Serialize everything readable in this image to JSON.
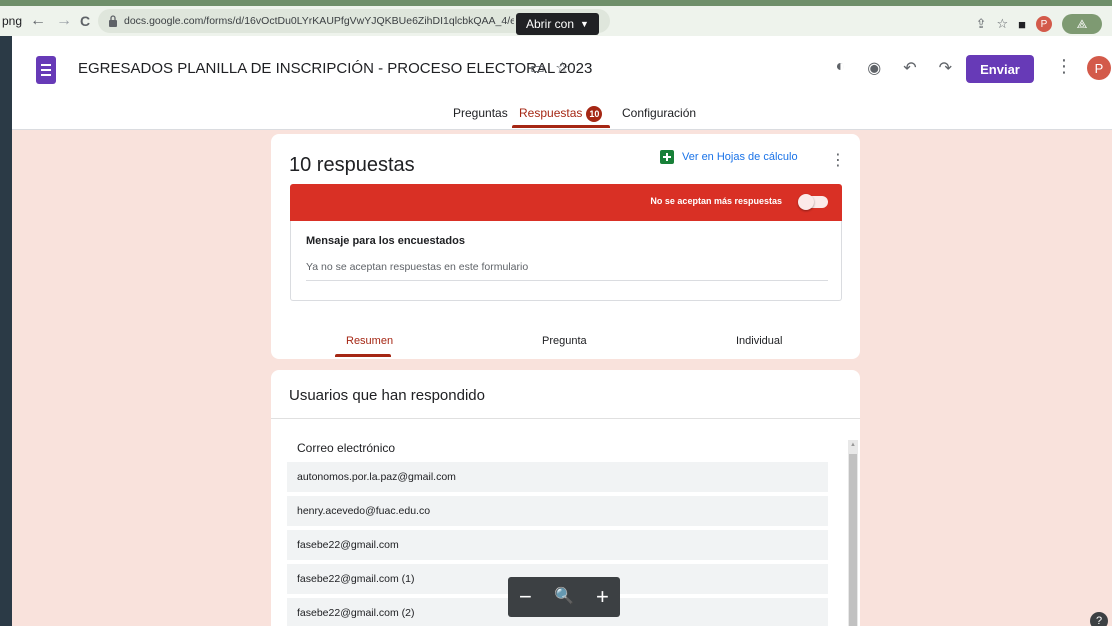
{
  "browser": {
    "ext_label": "png",
    "url": "docs.google.com/forms/d/16vOctDu0LYrKAUPfgVwYJQKBUe6ZihDI1qlcbkQAA_4/e",
    "open_with": "Abrir con"
  },
  "header": {
    "title": "EGRESADOS PLANILLA DE INSCRIPCIÓN - PROCESO ELECTORAL 2023",
    "send_label": "Enviar",
    "avatar_initial": "P",
    "tabs": {
      "questions": "Preguntas",
      "responses": "Respuestas",
      "responses_count": "10",
      "settings": "Configuración"
    }
  },
  "responses_card": {
    "count_label": "10 respuestas",
    "sheets_link": "Ver en Hojas de cálculo",
    "not_accepting": "No se aceptan más respuestas",
    "message_label": "Mensaje para los encuestados",
    "message_value": "Ya no se aceptan respuestas en este formulario",
    "subtabs": {
      "summary": "Resumen",
      "question": "Pregunta",
      "individual": "Individual"
    }
  },
  "users_card": {
    "title": "Usuarios que han respondido",
    "column_header": "Correo electrónico",
    "emails": [
      "autonomos.por.la.paz@gmail.com",
      "henry.acevedo@fuac.edu.co",
      "fasebe22@gmail.com",
      "fasebe22@gmail.com (1)",
      "fasebe22@gmail.com (2)"
    ]
  },
  "zoom": {
    "minus": "−",
    "search": "🔍",
    "plus": "+"
  },
  "help": "?",
  "colors": {
    "brand": "#673ab7",
    "accent": "#a52714",
    "alert": "#d93025",
    "background": "#f9e2dc"
  }
}
